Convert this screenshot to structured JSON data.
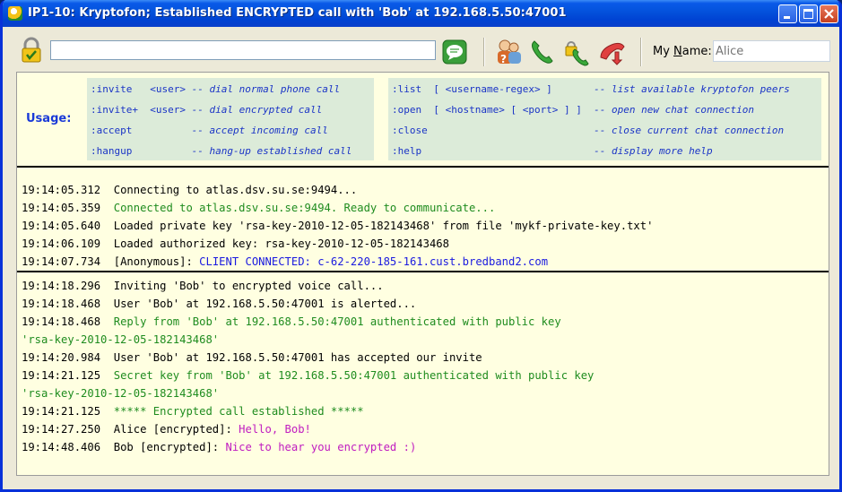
{
  "window": {
    "title": "IP1-10: Kryptofon; Established ENCRYPTED call with 'Bob' at 192.168.5.50:47001"
  },
  "toolbar": {
    "main_input_value": "",
    "my_name_label_prefix": "My ",
    "my_name_label_underlined": "N",
    "my_name_label_suffix": "ame:",
    "my_name_placeholder": "Alice"
  },
  "usage": {
    "label": "Usage:",
    "left": [
      {
        "cmd": ":invite   <user>",
        "desc": "-- dial normal phone call"
      },
      {
        "cmd": ":invite+  <user>",
        "desc": "-- dial encrypted call"
      },
      {
        "cmd": ":accept         ",
        "desc": "-- accept incoming call"
      },
      {
        "cmd": ":hangup         ",
        "desc": "-- hang-up established call"
      }
    ],
    "right": [
      {
        "cmd": ":list  [ <username-regex> ]      ",
        "desc": "-- list available kryptofon peers"
      },
      {
        "cmd": ":open  [ <hostname> [ <port> ] ] ",
        "desc": "-- open new chat connection"
      },
      {
        "cmd": ":close                           ",
        "desc": "-- close current chat connection"
      },
      {
        "cmd": ":help                            ",
        "desc": "-- display more help"
      }
    ]
  },
  "log_section_1": [
    {
      "ts": "19:14:05.312",
      "prefix": "",
      "msg": "Connecting to atlas.dsv.su.se:9494...",
      "color": "black"
    },
    {
      "ts": "19:14:05.359",
      "prefix": "",
      "msg": "Connected to atlas.dsv.su.se:9494. Ready to communicate...",
      "color": "green"
    },
    {
      "ts": "19:14:05.640",
      "prefix": "",
      "msg": "Loaded private key 'rsa-key-2010-12-05-182143468' from file 'mykf-private-key.txt'",
      "color": "black"
    },
    {
      "ts": "19:14:06.109",
      "prefix": "",
      "msg": "Loaded authorized key: rsa-key-2010-12-05-182143468",
      "color": "black"
    },
    {
      "ts": "19:14:07.734",
      "prefix": "[Anonymous]: ",
      "msg": "CLIENT CONNECTED: c-62-220-185-161.cust.bredband2.com",
      "color": "blue"
    }
  ],
  "log_section_2": [
    {
      "ts": "19:14:18.296",
      "prefix": "",
      "msg": "Inviting 'Bob' to encrypted voice call...",
      "color": "black"
    },
    {
      "ts": "19:14:18.468",
      "prefix": "",
      "msg": "User 'Bob' at 192.168.5.50:47001 is alerted...",
      "color": "black"
    },
    {
      "ts": "19:14:18.468",
      "prefix": "",
      "msg": "Reply from 'Bob' at 192.168.5.50:47001 authenticated with public key",
      "color": "green"
    },
    {
      "ts": "",
      "prefix": "",
      "msg": "'rsa-key-2010-12-05-182143468'",
      "color": "green"
    },
    {
      "ts": "19:14:20.984",
      "prefix": "",
      "msg": "User 'Bob' at 192.168.5.50:47001 has accepted our invite",
      "color": "black"
    },
    {
      "ts": "19:14:21.125",
      "prefix": "",
      "msg": "Secret key from 'Bob' at 192.168.5.50:47001 authenticated with public key",
      "color": "green"
    },
    {
      "ts": "",
      "prefix": "",
      "msg": "'rsa-key-2010-12-05-182143468'",
      "color": "green"
    },
    {
      "ts": "19:14:21.125",
      "prefix": "",
      "msg": "***** Encrypted call established *****",
      "color": "green"
    },
    {
      "ts": "19:14:27.250",
      "prefix": "Alice [encrypted]: ",
      "msg": "Hello, Bob!",
      "color": "magenta"
    },
    {
      "ts": "19:14:48.406",
      "prefix": "Bob [encrypted]: ",
      "msg": "Nice to hear you encrypted :)",
      "color": "magenta"
    }
  ],
  "colors": {
    "title_bar": "#0453dd",
    "content_bg": "#ffffe1",
    "usage_bg": "#dcebd9",
    "usage_text": "#1a34c6",
    "log_green": "#1f8c1f",
    "log_blue": "#1a1ae0",
    "log_magenta": "#c01cc0"
  },
  "icons": [
    "app-icon",
    "lock-icon",
    "chat-bubble-icon",
    "help-contacts-icon",
    "phone-call-icon",
    "encrypted-call-icon",
    "hangup-icon",
    "minimize-icon",
    "maximize-icon",
    "close-icon"
  ]
}
